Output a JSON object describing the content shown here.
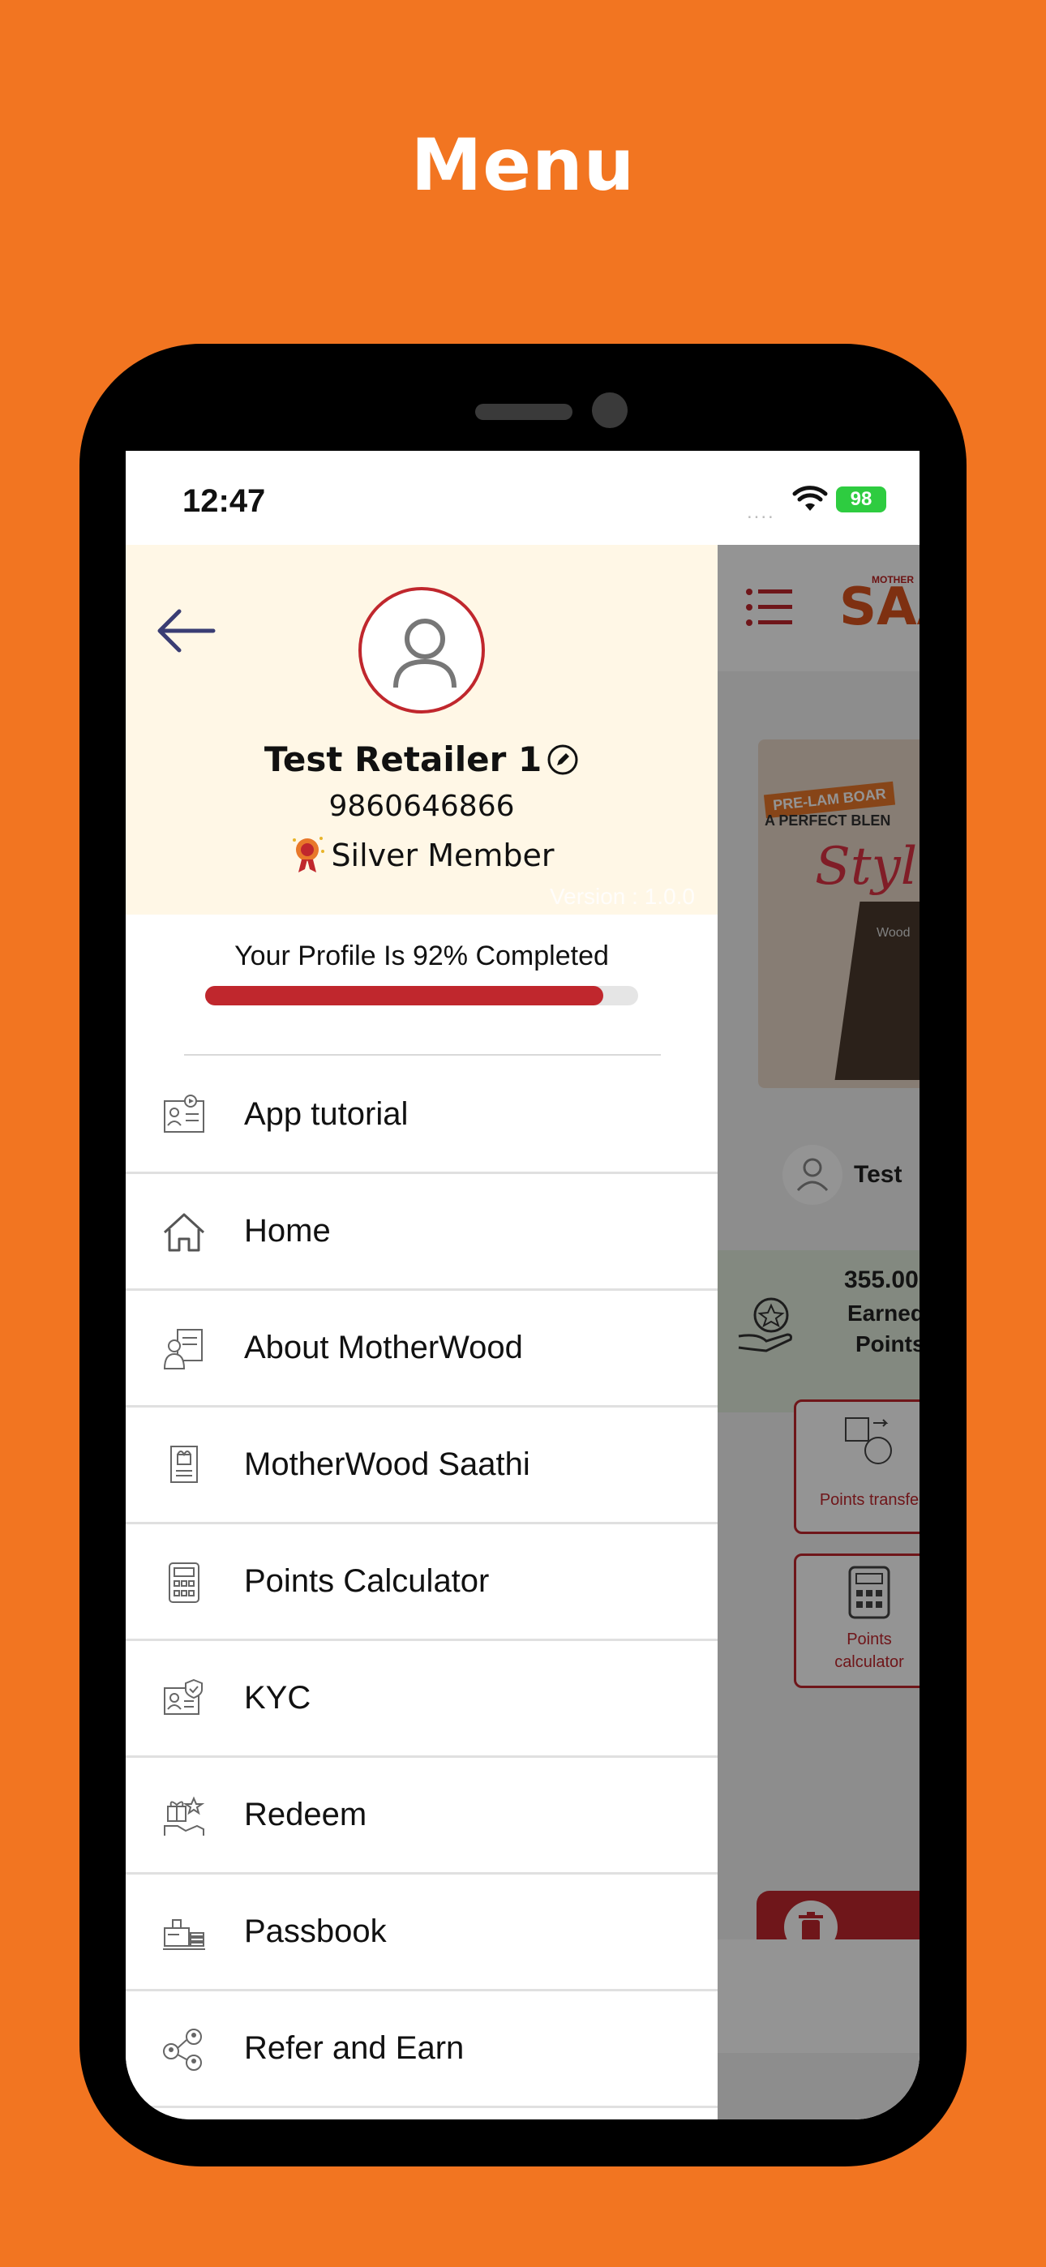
{
  "page": {
    "title": "Menu"
  },
  "status_bar": {
    "time": "12:47",
    "signal_dots": "....",
    "battery": "98"
  },
  "drawer": {
    "user_name": "Test Retailer 1",
    "phone": "9860646866",
    "membership": "Silver Member",
    "version": "Version : 1.0.0",
    "completion_text": "Your Profile Is 92% Completed",
    "completion_percent": 92,
    "menu_items": [
      {
        "label": "App tutorial",
        "icon": "video-tutorial-icon"
      },
      {
        "label": "Home",
        "icon": "home-icon"
      },
      {
        "label": "About MotherWood",
        "icon": "about-icon"
      },
      {
        "label": "MotherWood Saathi",
        "icon": "saathi-icon"
      },
      {
        "label": "Points Calculator",
        "icon": "calculator-icon"
      },
      {
        "label": "KYC",
        "icon": "kyc-icon"
      },
      {
        "label": "Redeem",
        "icon": "redeem-icon"
      },
      {
        "label": "Passbook",
        "icon": "passbook-icon"
      },
      {
        "label": "Refer and Earn",
        "icon": "refer-icon"
      }
    ]
  },
  "background_app": {
    "logo": "SAA",
    "logo_brand": "MOTHER",
    "banner_tag": "PRE-LAM BOAR",
    "banner_text": "A PERFECT BLEN",
    "banner_script": "Style",
    "banner_wood": "Wood",
    "username_partial": "Test",
    "points_value": "355.00",
    "points_label_1": "Earned",
    "points_label_2": "Points",
    "tile_1": "Points transfe",
    "tile_2_line1": "Points",
    "tile_2_line2": "calculator"
  },
  "colors": {
    "background": "#F27521",
    "accent": "#C0272D",
    "panel": "#FFF7E6"
  }
}
